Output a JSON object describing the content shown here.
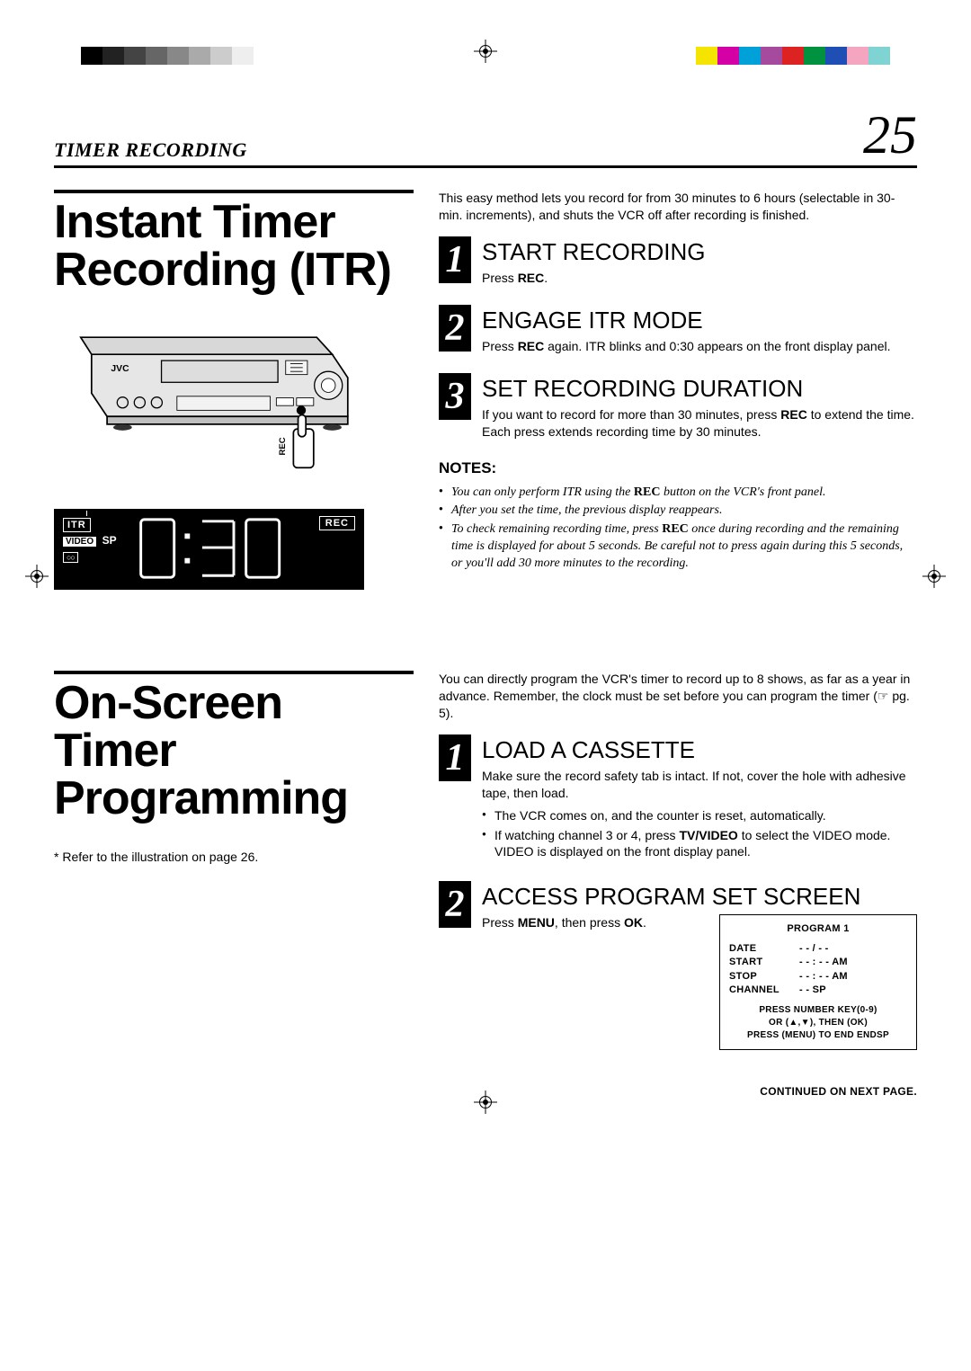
{
  "header": {
    "section": "TIMER RECORDING",
    "page": "25"
  },
  "reg": {
    "left_swatches": [
      "#000",
      "#222",
      "#444",
      "#666",
      "#888",
      "#aaa",
      "#ccc",
      "#eee"
    ],
    "right_swatches": [
      "#f5e400",
      "#d400a6",
      "#00a0d8",
      "#a54a9c",
      "#d22",
      "#00923f",
      "#1f4fb5",
      "#f4a6c0",
      "#7fd3d3"
    ]
  },
  "itr": {
    "title": "Instant Timer Recording (ITR)",
    "vcr_brand": "JVC",
    "rec_button_label": "REC",
    "display": {
      "itr": "ITR",
      "rec": "REC",
      "video": "VIDEO",
      "sp": "SP",
      "cassette": "○○",
      "digits": "0:30"
    },
    "intro": "This easy method lets you record for from 30 minutes to 6 hours (selectable in 30-min. increments), and shuts the VCR off after recording is finished.",
    "steps": [
      {
        "n": "1",
        "title": "START RECORDING",
        "text_pre": "Press ",
        "text_b": "REC",
        "text_post": "."
      },
      {
        "n": "2",
        "title": "ENGAGE ITR MODE",
        "text_pre": "Press ",
        "text_b": "REC",
        "text_post": " again. ITR blinks and 0:30 appears on the front display panel."
      },
      {
        "n": "3",
        "title": "SET RECORDING DURATION",
        "text_pre": "If you want to record for more than 30 minutes, press ",
        "text_b": "REC",
        "text_post": " to extend the time. Each press extends recording time by 30 minutes."
      }
    ],
    "notes_h": "NOTES:",
    "notes": [
      {
        "pre": "You can only perform ITR using the ",
        "b": "REC",
        "post": " button on the VCR's front panel."
      },
      {
        "pre": "After you set the time, the previous display reappears.",
        "b": "",
        "post": ""
      },
      {
        "pre": "To check remaining recording time, press ",
        "b": "REC",
        "post": " once during recording and the remaining time is displayed for about 5 seconds. Be careful not to press again during this 5 seconds, or you'll add 30 more minutes to the recording."
      }
    ]
  },
  "osp": {
    "title": "On-Screen Timer Programming",
    "ref": "*  Refer to the illustration on page 26.",
    "intro": "You can directly program the VCR's timer to record up to 8 shows, as far as a year in advance. Remember, the clock must be set before you can program the timer (☞ pg. 5).",
    "steps": [
      {
        "n": "1",
        "title": "LOAD A CASSETTE",
        "text": "Make sure the record safety tab is intact. If not, cover the hole with adhesive tape, then load.",
        "bullets": [
          "The VCR comes on, and the counter is reset, automatically.",
          {
            "pre": "If watching channel 3 or 4, press ",
            "b": "TV/VIDEO",
            "post": " to select the VIDEO mode. VIDEO is displayed on the front display panel."
          }
        ]
      },
      {
        "n": "2",
        "title": "ACCESS PROGRAM SET SCREEN",
        "text_pre": "Press ",
        "text_b1": "MENU",
        "text_mid": ", then press ",
        "text_b2": "OK",
        "text_post": "."
      }
    ],
    "program_screen": {
      "title": "PROGRAM 1",
      "rows": [
        {
          "k": "DATE",
          "v": "- - / - -"
        },
        {
          "k": "START",
          "v": "- - : - -  AM"
        },
        {
          "k": "STOP",
          "v": "- - : - -  AM"
        },
        {
          "k": "CHANNEL",
          "v": "- -  SP"
        }
      ],
      "help1": "PRESS NUMBER KEY(0-9)",
      "help2": "OR (▲,▼), THEN (OK)",
      "help3": "PRESS (MENU) TO END ENDSP"
    }
  },
  "continued": "CONTINUED ON NEXT PAGE."
}
